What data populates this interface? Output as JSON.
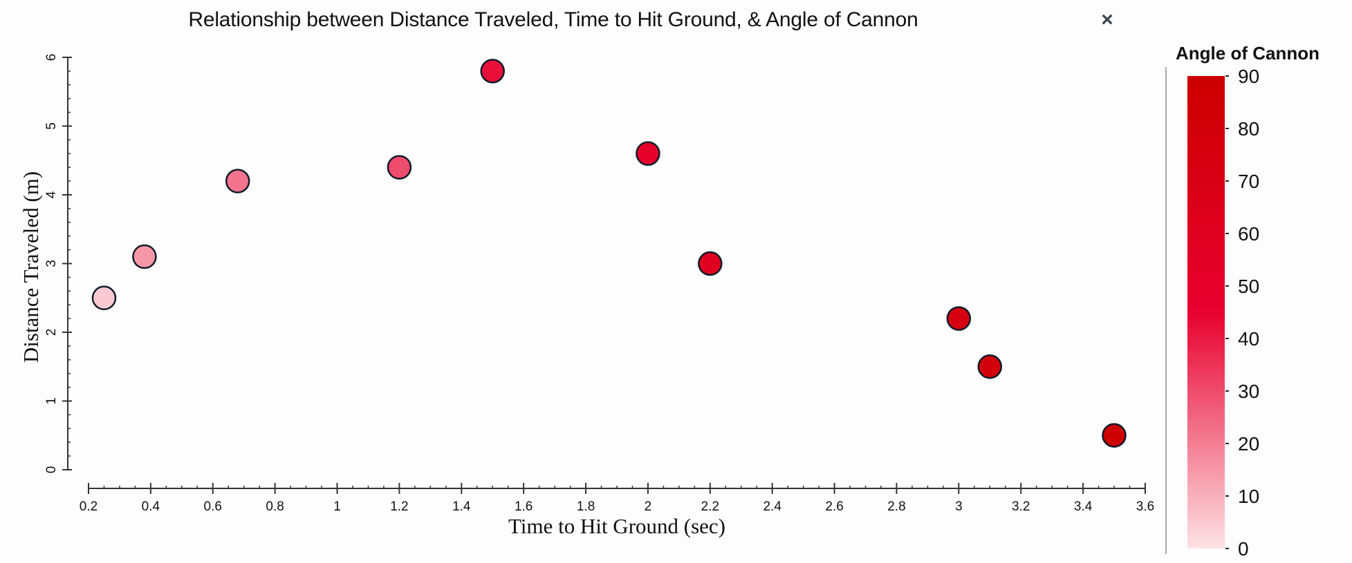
{
  "window": {
    "close_label": "×",
    "close_icon": "close-icon"
  },
  "colors": {
    "axis": "#333333",
    "marker_edge": "#0f1b2a",
    "colormap_low": "#fde2e5",
    "colormap_mid": "#e8002f",
    "colormap_high": "#cc0000",
    "close_icon": "#3d4550"
  },
  "chart_data": {
    "type": "scatter",
    "title": "Relationship between Distance Traveled, Time to Hit Ground, & Angle of Cannon",
    "xlabel": "Time to Hit Ground (sec)",
    "ylabel": "Distance Traveled (m)",
    "xlim": [
      0.2,
      3.6
    ],
    "ylim": [
      0,
      6
    ],
    "xticks": [
      0.2,
      0.4,
      0.6,
      0.8,
      1,
      1.2,
      1.4,
      1.6,
      1.8,
      2,
      2.2,
      2.4,
      2.6,
      2.8,
      3,
      3.2,
      3.4,
      3.6
    ],
    "yticks": [
      0,
      1,
      2,
      3,
      4,
      5,
      6
    ],
    "x_minor_step": 0.05,
    "y_minor_step": 0.2,
    "grid": false,
    "points": [
      {
        "x": 0.25,
        "y": 2.5,
        "angle": 5
      },
      {
        "x": 0.38,
        "y": 3.1,
        "angle": 15
      },
      {
        "x": 0.68,
        "y": 4.2,
        "angle": 22
      },
      {
        "x": 1.2,
        "y": 4.4,
        "angle": 30
      },
      {
        "x": 1.5,
        "y": 5.8,
        "angle": 42
      },
      {
        "x": 2.0,
        "y": 4.6,
        "angle": 50
      },
      {
        "x": 2.2,
        "y": 3.0,
        "angle": 60
      },
      {
        "x": 3.0,
        "y": 2.2,
        "angle": 75
      },
      {
        "x": 3.1,
        "y": 1.5,
        "angle": 80
      },
      {
        "x": 3.5,
        "y": 0.5,
        "angle": 88
      }
    ],
    "colorbar": {
      "title": "Angle of Cannon",
      "range": [
        0,
        90
      ],
      "ticks": [
        0,
        10,
        20,
        30,
        40,
        50,
        60,
        70,
        80,
        90
      ],
      "placement": "right"
    }
  }
}
